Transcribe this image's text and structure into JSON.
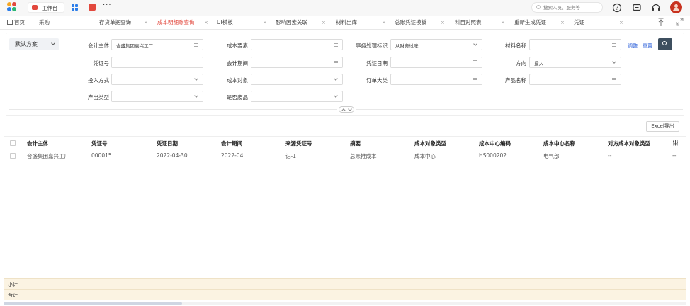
{
  "topbar": {
    "workbench_label": "工作台",
    "more_label": "···",
    "search_placeholder": "搜索人员、服务等"
  },
  "tabs": [
    {
      "label": "首页",
      "closable": false
    },
    {
      "label": "采购",
      "closable": false
    },
    {
      "label": "存货单据查询",
      "closable": true
    },
    {
      "label": "成本明细账查询",
      "closable": true,
      "active": true
    },
    {
      "label": "UI模板",
      "closable": true
    },
    {
      "label": "影响因素关联",
      "closable": true
    },
    {
      "label": "材料出库",
      "closable": true
    },
    {
      "label": "总账凭证模板",
      "closable": true
    },
    {
      "label": "科目对照表",
      "closable": true
    },
    {
      "label": "重新生成凭证",
      "closable": true
    },
    {
      "label": "凭证",
      "closable": true
    }
  ],
  "tab_close_glyph": "×",
  "filter": {
    "scheme_label": "默认方案",
    "adjust_label": "调整",
    "reset_label": "重置",
    "fields": {
      "entity": {
        "label": "会计主体",
        "value": "合盛集团嘉兴工厂"
      },
      "cost_element": {
        "label": "成本要素",
        "value": ""
      },
      "process_flag": {
        "label": "事务处理标识",
        "value": "从财务过账"
      },
      "material_name": {
        "label": "材料名称",
        "value": ""
      },
      "voucher_no": {
        "label": "凭证号",
        "value": ""
      },
      "period": {
        "label": "会计期间",
        "value": ""
      },
      "voucher_date": {
        "label": "凭证日期",
        "value": ""
      },
      "direction": {
        "label": "方向",
        "value": "投入"
      },
      "input_mode": {
        "label": "投入方式",
        "value": ""
      },
      "cost_object": {
        "label": "成本对象",
        "value": ""
      },
      "order_category": {
        "label": "订单大类",
        "value": ""
      },
      "product_name": {
        "label": "产品名称",
        "value": ""
      },
      "output_type": {
        "label": "产出类型",
        "value": ""
      },
      "is_waste": {
        "label": "是否废品",
        "value": ""
      }
    }
  },
  "excel_export_label": "Excel导出",
  "table": {
    "columns": [
      "会计主体",
      "凭证号",
      "凭证日期",
      "会计期间",
      "来源凭证号",
      "摘要",
      "成本对象类型",
      "成本中心编码",
      "成本中心名称",
      "对方成本对象类型"
    ],
    "rows": [
      [
        "合盛集团嘉兴工厂",
        "000015",
        "2022-04-30",
        "2022-04",
        "记-1",
        "总账推成本",
        "成本中心",
        "HS000202",
        "电气部",
        "--",
        "--"
      ]
    ]
  },
  "summary": {
    "subtotal_label": "小计",
    "total_label": "合计"
  },
  "colors": {
    "accent_red": "#e2483d",
    "link_blue": "#2b5fd9",
    "summary_bg": "#fbf3e2"
  }
}
